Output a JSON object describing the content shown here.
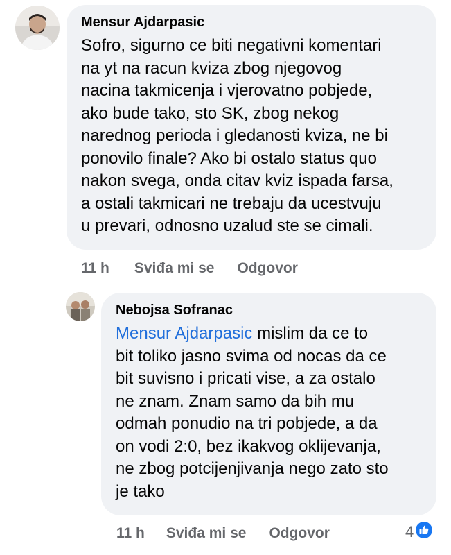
{
  "comments": [
    {
      "author": "Mensur Ajdarpasic",
      "lines": [
        "Sofro, sigurno ce biti negativni komentari",
        "na yt na racun kviza zbog njegovog",
        "nacina takmicenja i vjerovatno pobjede,",
        "ako bude tako, sto SK, zbog nekog",
        "narednog perioda i gledanosti kviza, ne bi",
        "ponovilo finale? Ako bi ostalo status quo",
        "nakon svega, onda citav kviz ispada farsa,",
        "a ostali takmicari ne trebaju da ucestvuju",
        "u prevari, odnosno uzalud ste se cimali."
      ],
      "time": "11 h",
      "like_label": "Sviđa mi se",
      "reply_label": "Odgovor"
    },
    {
      "author": "Nebojsa Sofranac",
      "mention": "Mensur Ajdarpasic",
      "first_line_rest": " mislim da ce to",
      "lines": [
        "bit toliko jasno svima od nocas da ce",
        "bit suvisno i pricati vise, a za ostalo",
        "ne znam. Znam samo da bih mu",
        "odmah ponudio na tri pobjede, a da",
        "on vodi 2:0, bez ikakvog oklijevanja,",
        "ne zbog potcijenjivanja nego zato sto",
        "je tako"
      ],
      "time": "11 h",
      "like_label": "Sviđa mi se",
      "reply_label": "Odgovor",
      "reaction_count": "4",
      "reaction_icon": "like-icon"
    }
  ],
  "colors": {
    "bubble": "#f0f2f5",
    "mention": "#216fdb",
    "meta": "#65676b",
    "like_blue": "#1877f2"
  }
}
